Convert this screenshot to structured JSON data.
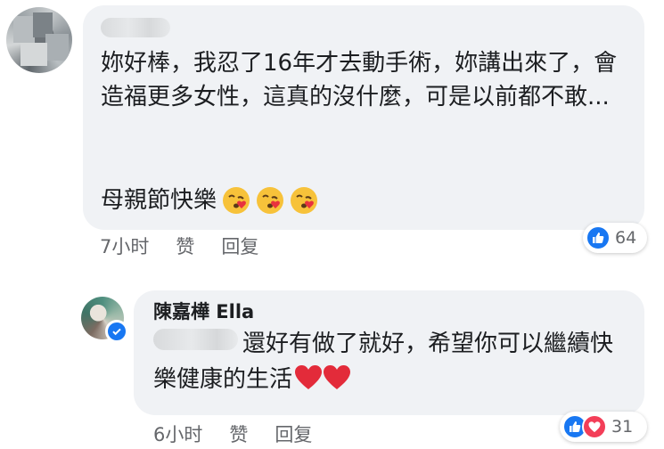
{
  "comment": {
    "text": "妳好棒，我忍了16年才去動手術，妳講出來了，會造福更多女性，這真的沒什麼，可是以前都不敢...",
    "text_line2": "母親節快樂",
    "emoji": [
      "kissing-heart-emoji",
      "kissing-heart-emoji",
      "kissing-heart-emoji"
    ],
    "time": "7小时",
    "like_label": "赞",
    "reply_label": "回复",
    "reaction_count": "64"
  },
  "reply": {
    "author": "陳嘉樺 Ella",
    "text": "還好有做了就好，希望你可以繼續快樂健康的生活",
    "time": "6小时",
    "like_label": "赞",
    "reply_label": "回复",
    "reaction_count": "31"
  },
  "colors": {
    "bubble": "#f0f2f5",
    "meta": "#65676b",
    "like": "#1877f2",
    "love": "#f33e58"
  }
}
